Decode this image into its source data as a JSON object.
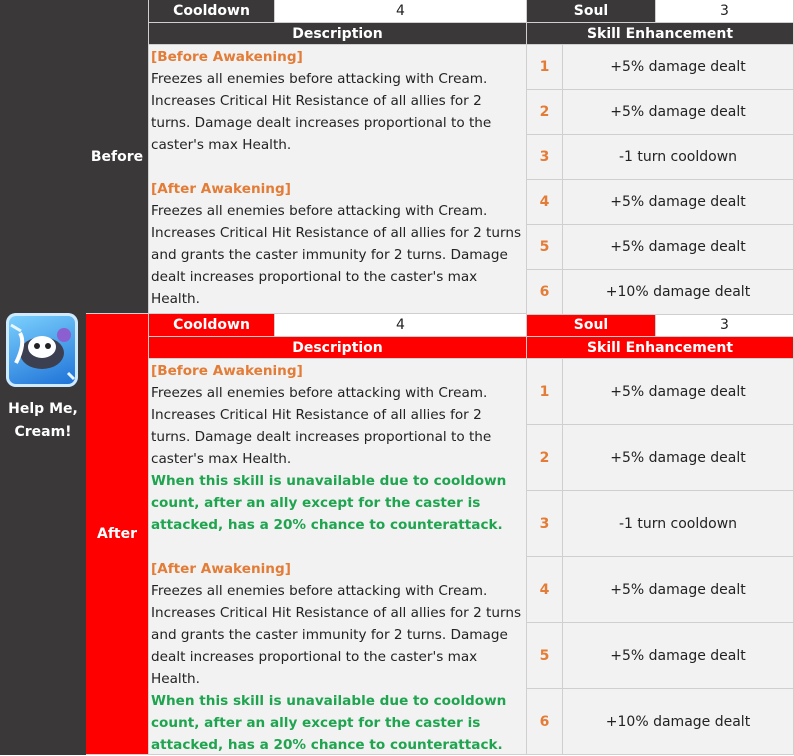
{
  "skill": {
    "name_line1": "Help Me,",
    "name_line2": "Cream!",
    "icon": "cream-skill-icon"
  },
  "colors": {
    "before_header": "#3a3838",
    "after_header": "#ff0000",
    "tag": "#e37c36",
    "green": "#1fa44f"
  },
  "labels": {
    "cooldown": "Cooldown",
    "soul": "Soul",
    "description": "Description",
    "skill_enhancement": "Skill Enhancement",
    "before": "Before",
    "after": "After"
  },
  "before": {
    "cooldown": "4",
    "soul": "3",
    "before_awakening_tag": "[Before Awakening]",
    "before_awakening_text": "Freezes all enemies before attacking with Cream. Increases Critical Hit Resistance of all allies for 2 turns.  Damage dealt increases proportional to the caster's max Health.",
    "after_awakening_tag": "[After Awakening]",
    "after_awakening_text": "Freezes all enemies before attacking with Cream. Increases Critical Hit Resistance of all allies for 2 turns and grants the caster immunity for 2 turns. Damage dealt increases proportional to the caster's max Health.",
    "enhancements": [
      {
        "level": "1",
        "effect": "+5% damage dealt"
      },
      {
        "level": "2",
        "effect": "+5% damage dealt"
      },
      {
        "level": "3",
        "effect": "-1 turn cooldown"
      },
      {
        "level": "4",
        "effect": "+5% damage dealt"
      },
      {
        "level": "5",
        "effect": "+5% damage dealt"
      },
      {
        "level": "6",
        "effect": "+10% damage dealt"
      }
    ]
  },
  "after": {
    "cooldown": "4",
    "soul": "3",
    "before_awakening_tag": "[Before Awakening]",
    "before_awakening_text": "Freezes all enemies before attacking with Cream. Increases Critical Hit Resistance of all allies for 2 turns.  Damage dealt increases proportional to the caster's max Health.",
    "before_awakening_new": "When this skill is unavailable due to cooldown count, after an ally except for the caster is attacked, has a 20% chance to counterattack.",
    "after_awakening_tag": "[After Awakening]",
    "after_awakening_text": "Freezes all enemies before attacking with Cream. Increases Critical Hit Resistance of all allies for 2 turns and grants the caster immunity for 2 turns. Damage dealt increases proportional to the caster's max Health.",
    "after_awakening_new": "When this skill is unavailable due to cooldown count, after an ally except for the caster is attacked, has a 20% chance to counterattack.",
    "enhancements": [
      {
        "level": "1",
        "effect": "+5% damage dealt"
      },
      {
        "level": "2",
        "effect": "+5% damage dealt"
      },
      {
        "level": "3",
        "effect": "-1 turn cooldown"
      },
      {
        "level": "4",
        "effect": "+5% damage dealt"
      },
      {
        "level": "5",
        "effect": "+5% damage dealt"
      },
      {
        "level": "6",
        "effect": "+10% damage dealt"
      }
    ]
  }
}
